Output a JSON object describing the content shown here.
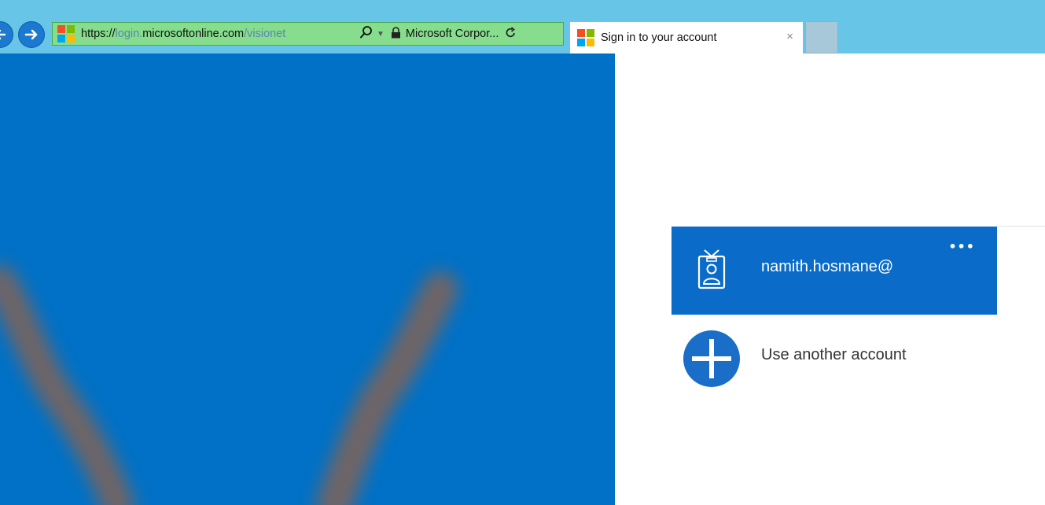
{
  "browser": {
    "address": {
      "url_scheme": "https://",
      "url_sub": "login.",
      "url_domain": "microsoftonline.com",
      "url_path": "/visionet",
      "certificate": "Microsoft Corpor..."
    },
    "tab": {
      "title": "Sign in to your account",
      "close": "×"
    }
  },
  "accounts": {
    "primary": {
      "name": "namith.hosmane@",
      "more": "•••"
    },
    "another": {
      "label": "Use another account"
    }
  },
  "icons": {
    "back": "arrow-left-icon",
    "forward": "arrow-right-icon",
    "search": "search-icon",
    "lock": "lock-icon",
    "refresh": "refresh-icon",
    "badge": "id-badge-icon",
    "plus": "plus-icon"
  },
  "colors": {
    "chrome": "#67c6e8",
    "address_bar": "#86dd8d",
    "brand_blue": "#0071c6",
    "tile_blue": "#0a6cc8",
    "ms_red": "#f25022",
    "ms_green": "#7fba00",
    "ms_blue": "#00a4ef",
    "ms_yellow": "#ffb900"
  }
}
